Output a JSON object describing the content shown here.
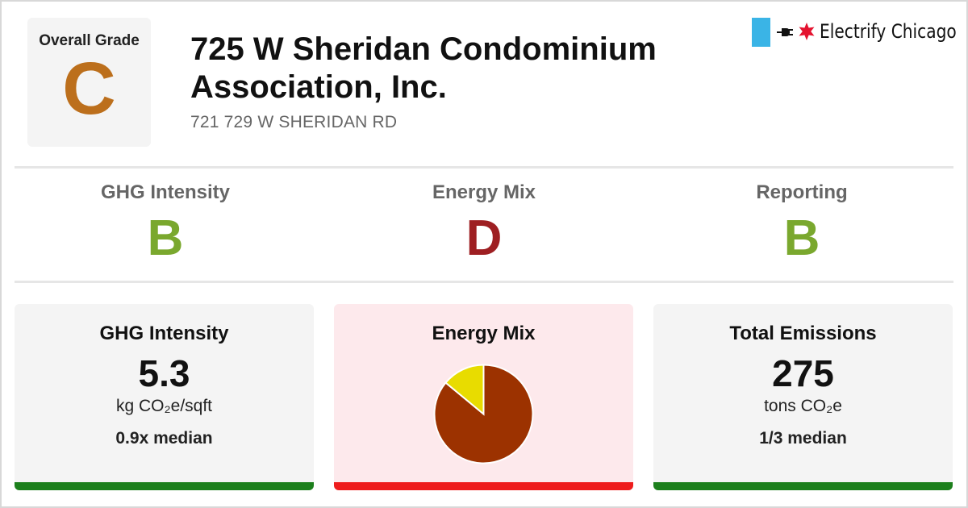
{
  "overall": {
    "label": "Overall Grade",
    "grade": "C",
    "color": "#bc6f1c"
  },
  "building": {
    "name": "725 W Sheridan Condominium Association, Inc.",
    "address": "721 729 W SHERIDAN RD"
  },
  "logo": {
    "text": "Electrify Chicago",
    "icons": [
      "plug-icon",
      "chicago-star-icon"
    ],
    "bar_color": "#3ab4e6",
    "star_color": "#e4132f"
  },
  "subgrades": [
    {
      "label": "GHG Intensity",
      "grade": "B",
      "color": "#7aa82e"
    },
    {
      "label": "Energy Mix",
      "grade": "D",
      "color": "#9e1f22"
    },
    {
      "label": "Reporting",
      "grade": "B",
      "color": "#7aa82e"
    }
  ],
  "cards": {
    "ghg": {
      "title": "GHG Intensity",
      "value": "5.3",
      "unit": "kg CO₂e/sqft",
      "median": "0.9x median",
      "bar_color": "#1c7f1c"
    },
    "mix": {
      "title": "Energy Mix",
      "bar_color": "#ee1c1c"
    },
    "emissions": {
      "title": "Total Emissions",
      "value": "275",
      "unit": "tons CO₂e",
      "median": "1/3 median",
      "bar_color": "#1c7f1c"
    }
  },
  "chart_data": {
    "type": "pie",
    "title": "",
    "slices": [
      {
        "value": 0.86,
        "color": "#9c3200"
      },
      {
        "value": 0.14,
        "color": "#e8dc00"
      }
    ]
  }
}
